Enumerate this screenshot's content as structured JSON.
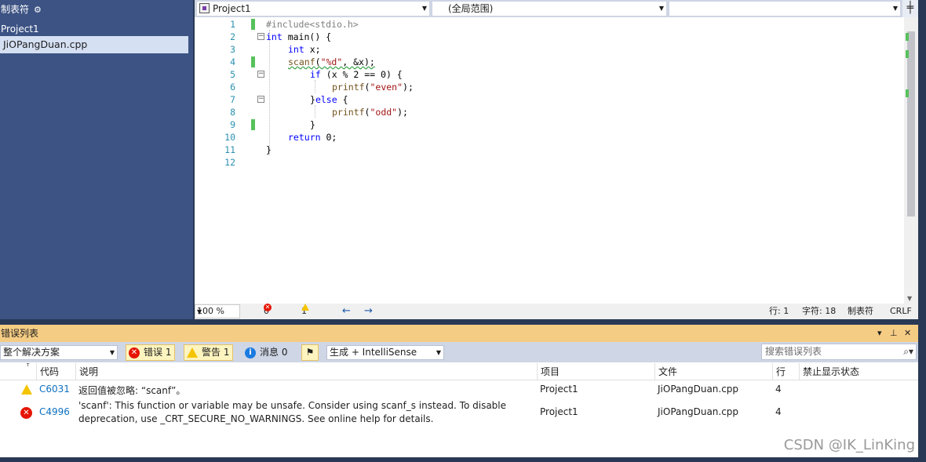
{
  "left_panel": {
    "title": "制表符",
    "project": "Project1",
    "file": "JiOPangDuan.cpp"
  },
  "nav": {
    "project": "Project1",
    "scope": "(全局范围)",
    "member": ""
  },
  "line_numbers": [
    "1",
    "2",
    "3",
    "4",
    "5",
    "6",
    "7",
    "8",
    "9",
    "10",
    "11",
    "12"
  ],
  "code": {
    "l1_pp": "#include<stdio.h>",
    "l2_kw": "int",
    "l2_rest": " main() {",
    "l3_kw": "int",
    "l3_rest": " x;",
    "l4_fn": "scanf",
    "l4_a": "(",
    "l4_str": "\"%d\"",
    "l4_b": ", &x);",
    "l5_kw": "if",
    "l5_rest": " (x % 2 == 0) {",
    "l6_fn": "printf",
    "l6_a": "(",
    "l6_str": "\"even\"",
    "l6_b": ");",
    "l7_a": "}",
    "l7_kw": "else",
    "l7_b": " {",
    "l8_fn": "printf",
    "l8_a": "(",
    "l8_str": "\"odd\"",
    "l8_b": ");",
    "l9": "}",
    "l10_kw": "return",
    "l10_rest": " 0;",
    "l11": "}"
  },
  "status_bar": {
    "zoom": "100 %",
    "errors": "0",
    "warnings": "1",
    "line": "行: 1",
    "char": "字符: 18",
    "tabs": "制表符",
    "eol": "CRLF"
  },
  "error_list": {
    "title": "错误列表",
    "scope": "整个解决方案",
    "errors_btn": "错误 1",
    "warnings_btn": "警告 1",
    "messages_btn": "消息 0",
    "build_filter": "生成 + IntelliSense",
    "search_placeholder": "搜索错误列表",
    "columns": [
      "代码",
      "说明",
      "项目",
      "文件",
      "行",
      "禁止显示状态"
    ],
    "rows": [
      {
        "severity": "warning",
        "code": "C6031",
        "description": "返回值被忽略: “scanf”。",
        "project": "Project1",
        "file": "JiOPangDuan.cpp",
        "line": "4",
        "suppression": ""
      },
      {
        "severity": "error",
        "code": "C4996",
        "description_1": "'scanf': This function or variable may be unsafe. Consider using scanf_s instead. To disable",
        "description_2": "deprecation, use _CRT_SECURE_NO_WARNINGS. See online help for details.",
        "project": "Project1",
        "file": "JiOPangDuan.cpp",
        "line": "4",
        "suppression": ""
      }
    ]
  },
  "watermark": "CSDN @IK_LinKing",
  "colors": {
    "chrome": "#293955",
    "side_panel": "#3c5384",
    "tool_title": "#f5cc84",
    "keyword": "#0000ff",
    "string": "#a31515",
    "line_number": "#2b91af",
    "change_bar": "#57c15b"
  }
}
